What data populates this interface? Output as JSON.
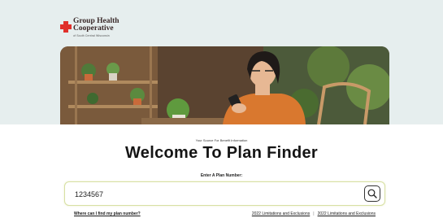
{
  "logo": {
    "line1": "Group Health",
    "line2": "Cooperative",
    "subline": "of South Central Wisconsin",
    "icon": "red-cross-icon",
    "brand_color": "#e0302b"
  },
  "hero": {
    "image": "woman-using-smartphone-photo"
  },
  "tagline": "Your Source For Benefit Information",
  "title": "Welcome To Plan Finder",
  "search": {
    "label": "Enter A Plan Number:",
    "value": "1234567",
    "button_icon": "search-icon"
  },
  "links": {
    "help": "Where can I find my plan number?",
    "limitations_a": "2022 Limitations and Exclusions",
    "separator": "|",
    "limitations_b": "2022 Limitations and Exclusions"
  }
}
